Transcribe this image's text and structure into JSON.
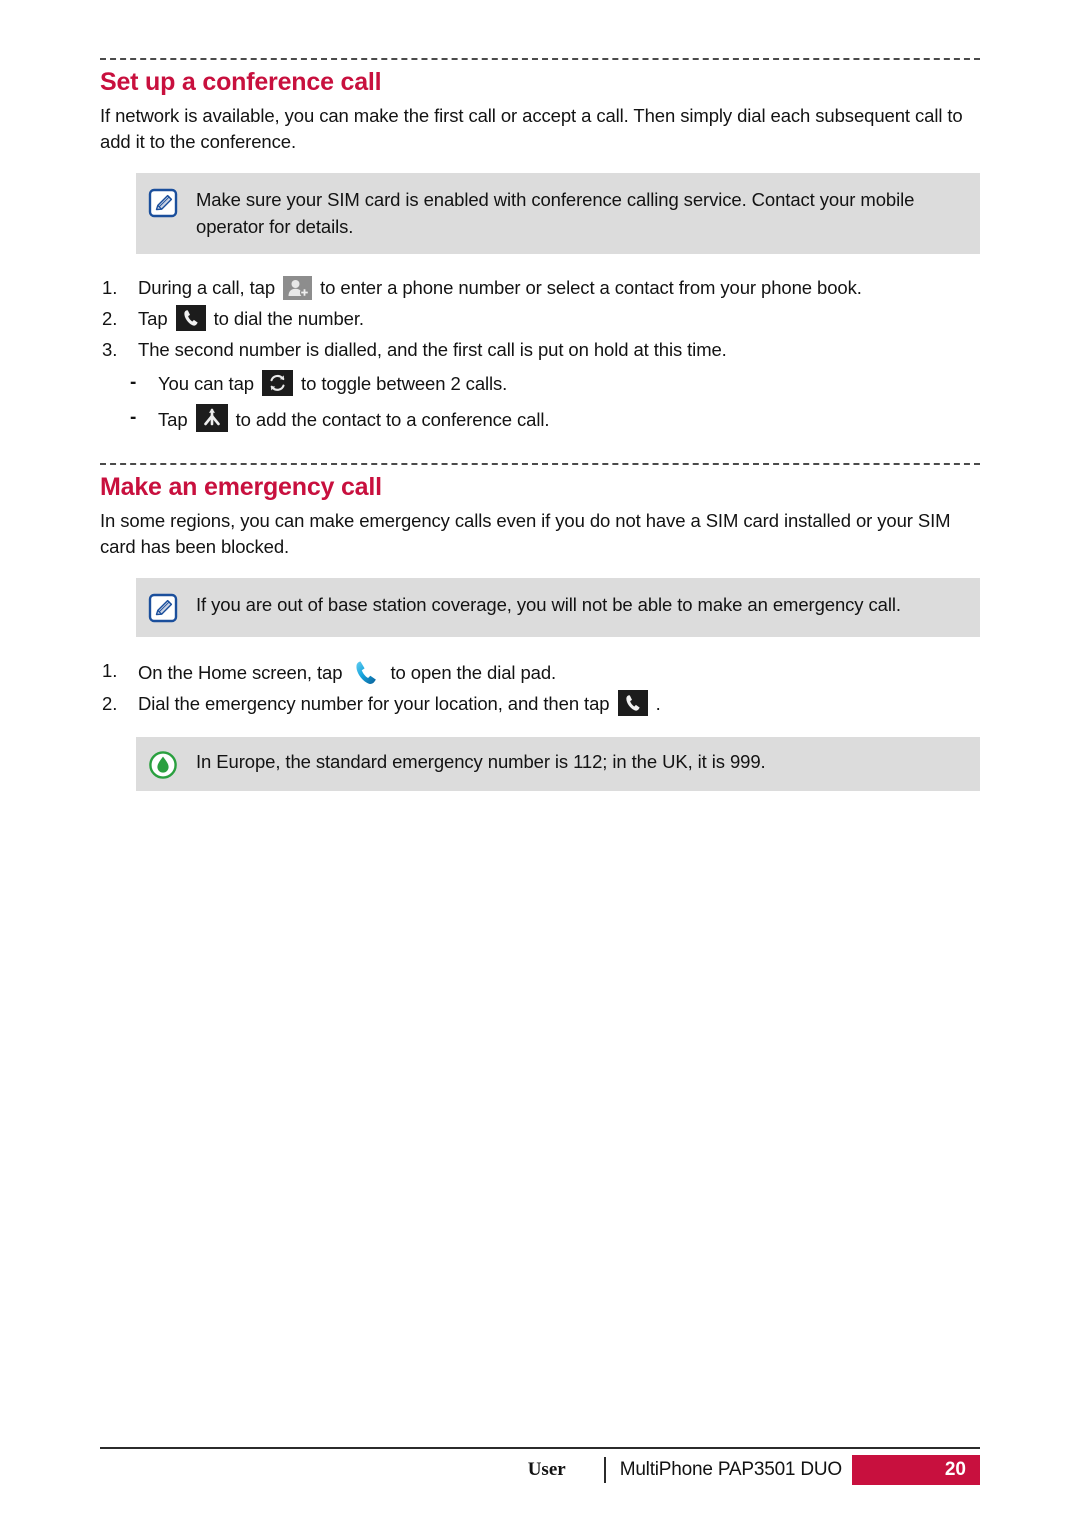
{
  "theme": {
    "heading_color": "#c8103e",
    "callout_bg": "#dcdcdc",
    "note_icon_color": "#1b4f9c",
    "tip_icon_color": "#2aa03f",
    "dark_chip_bg": "#1c1c1c",
    "blue_phone_color": "#1e9fd6"
  },
  "sections": [
    {
      "title": "Set up a conference call",
      "intro": "If network is available, you can make the first call or accept a call. Then simply dial each subsequent call to add it to the conference.",
      "note": {
        "icon": "note-pencil-icon",
        "text": "Make sure your SIM card is enabled with conference calling service. Contact your mobile operator for details."
      },
      "steps": [
        {
          "num": "1.",
          "text_before": "During a call, tap",
          "icon": "add-contact-icon",
          "text_after": "to enter a phone number or select a contact from your phone book."
        },
        {
          "num": "2.",
          "text_before": "Tap",
          "icon": "call-dial-icon",
          "text_after": "to dial the number."
        },
        {
          "num": "3.",
          "text_before": "The second number is dialled, and the first call is put on hold at this time.",
          "icon": "",
          "text_after": ""
        }
      ],
      "substeps": [
        {
          "dash": "-",
          "text_before": "You can tap",
          "icon": "swap-calls-icon",
          "text_after": "to toggle between 2 calls."
        },
        {
          "dash": "-",
          "text_before": "Tap",
          "icon": "merge-calls-icon",
          "text_after": "to add the contact to a conference call."
        }
      ]
    },
    {
      "title": "Make an emergency call",
      "intro": "In some regions, you can make emergency calls even if you do not have a SIM card installed or your SIM card has been blocked.",
      "note": {
        "icon": "note-pencil-icon",
        "text": "If you are out of base station coverage, you will not be able to make an emergency call."
      },
      "steps": [
        {
          "num": "1.",
          "text_before": "On the Home screen, tap",
          "icon": "blue-phone-icon",
          "text_after": "to open the dial pad."
        },
        {
          "num": "2.",
          "text_before": "Dial the emergency number for your location, and then tap",
          "icon": "call-dial-icon",
          "text_after": "."
        }
      ],
      "tip": {
        "icon": "tip-droplet-icon",
        "text": "In Europe, the standard emergency number is 112; in the UK, it is 999."
      }
    }
  ],
  "footer": {
    "user_label": "User",
    "model": "MultiPhone PAP3501 DUO",
    "page_number": "20"
  }
}
